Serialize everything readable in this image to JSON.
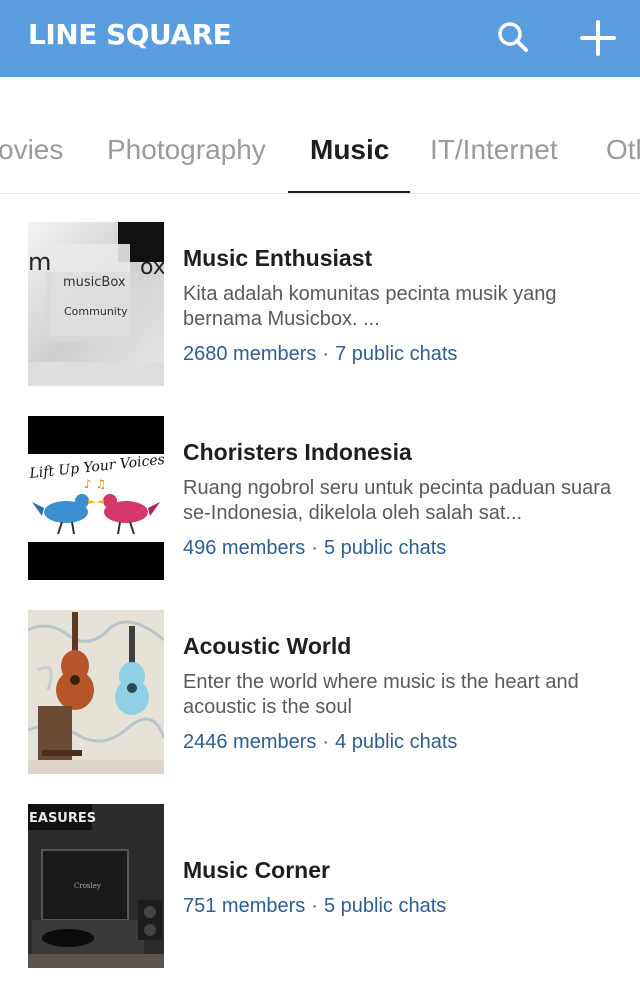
{
  "app": {
    "title": "LINE SQUARE",
    "header_color": "#5b9ee0",
    "search_icon": "search-icon",
    "add_icon": "plus-icon"
  },
  "tabs": [
    {
      "label": "Movies",
      "visible_label": "ovies",
      "active": false
    },
    {
      "label": "Photography",
      "active": false
    },
    {
      "label": "Music",
      "active": true
    },
    {
      "label": "IT/Internet",
      "active": false
    },
    {
      "label": "Others",
      "visible_label": "Otl",
      "active": false
    }
  ],
  "communities": [
    {
      "title": "Music Enthusiast",
      "desc": "Kita adalah komunitas pecinta musik yang bernama Musicbox. ...",
      "members": "2680 members",
      "separator": "·",
      "chats": "7 public chats",
      "thumb_text_1": "musicBox",
      "thumb_text_2": "Community",
      "thumb_text_3": "m",
      "thumb_text_4": "ox"
    },
    {
      "title": "Choristers Indonesia",
      "desc": "Ruang ngobrol seru untuk pecinta paduan suara se-Indonesia, dikelola oleh salah sat...",
      "members": "496 members",
      "separator": "·",
      "chats": "5 public chats",
      "thumb_text": "Lift Up Your Voices"
    },
    {
      "title": "Acoustic World",
      "desc": "Enter the world where music is the heart and acoustic is the soul",
      "members": "2446 members",
      "separator": "·",
      "chats": "4 public chats"
    },
    {
      "title": "Music Corner",
      "members": "751 members",
      "separator": "·",
      "chats": "5 public chats",
      "thumb_text": "EASURES"
    }
  ]
}
